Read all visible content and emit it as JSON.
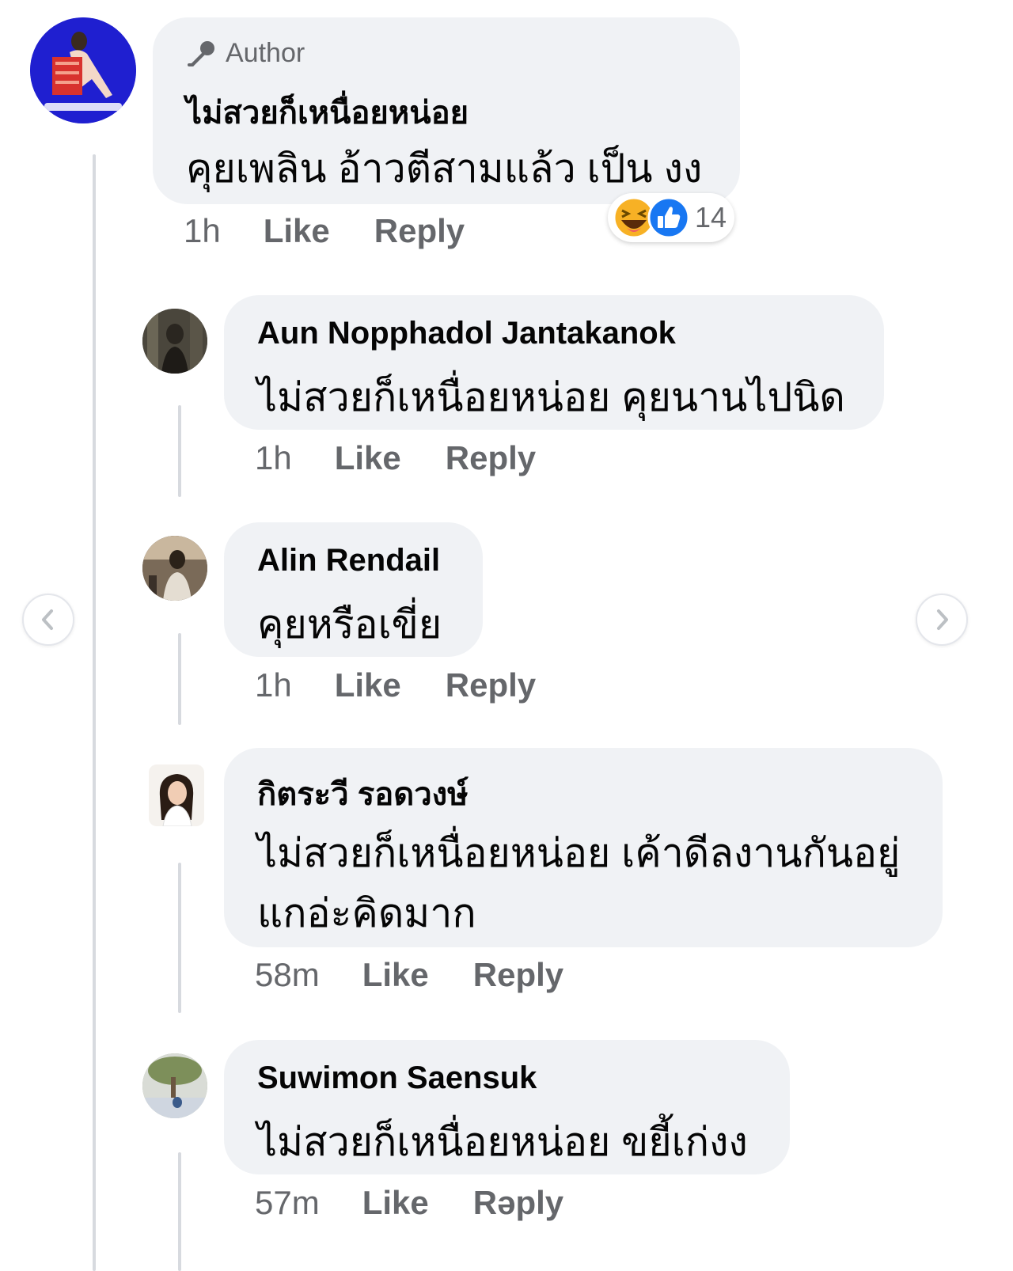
{
  "comments": [
    {
      "badge": "Author",
      "name": "ไม่สวยก็เหนื่อยหน่อย",
      "text": "คุยเพลิน อ้าวตีสามแล้ว เป็น งง",
      "time": "1h",
      "like": "Like",
      "reply": "Reply",
      "reaction_count": "14"
    },
    {
      "name": "Aun Nopphadol Jantakanok",
      "text": "ไม่สวยก็เหนื่อยหน่อย คุยนานไปนิด",
      "time": "1h",
      "like": "Like",
      "reply": "Reply"
    },
    {
      "name": "Alin Rendail",
      "text": "คุยหรือเขี่ย",
      "time": "1h",
      "like": "Like",
      "reply": "Reply"
    },
    {
      "name": "กิตระวี รอดวงษ์",
      "text": "ไม่สวยก็เหนื่อยหน่อย เค้าดีลงานกันอยู่",
      "text_line2": "แกอ่ะคิดมาก",
      "time": "58m",
      "like": "Like",
      "reply": "Reply"
    },
    {
      "name": "Suwimon Saensuk",
      "text": "ไม่สวยก็เหนื่อยหน่อย ขยี้เก่งง",
      "time": "57m",
      "like": "Like",
      "reply": "Rəply"
    }
  ],
  "icons": {
    "author_badge": "microphone-icon",
    "reactions": [
      "haha-icon",
      "like-icon"
    ],
    "nav": [
      "chevron-left-icon",
      "chevron-right-icon"
    ]
  },
  "colors": {
    "bubble": "#f0f2f5",
    "meta_text": "#65676b",
    "like_blue": "#1877f2",
    "haha_yellow": "#f7b125",
    "page_avatar_blue": "#1f1fd0"
  }
}
